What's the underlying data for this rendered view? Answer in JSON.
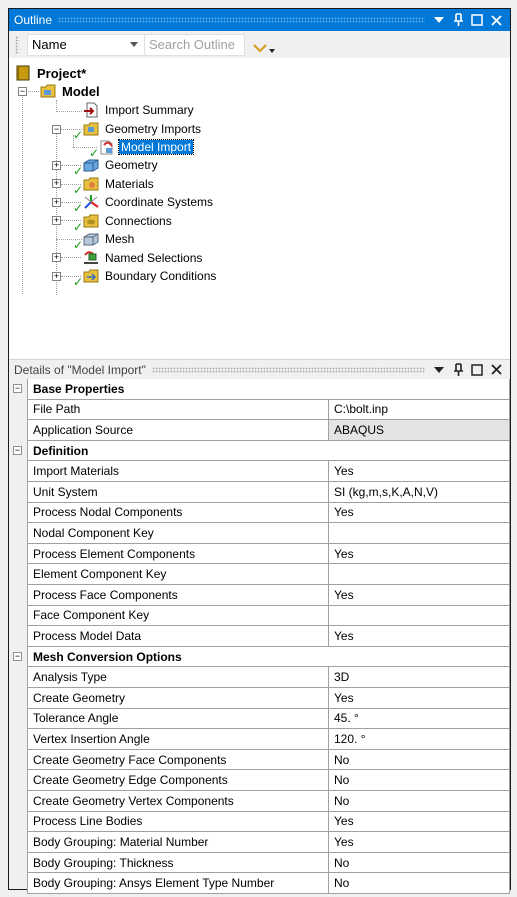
{
  "outline": {
    "title": "Outline",
    "toolbar": {
      "name_select": "Name",
      "search_placeholder": "Search Outline"
    },
    "tree": [
      {
        "label": "Project*",
        "icon": "project-icon",
        "bold": true
      },
      {
        "label": "Model",
        "icon": "model-folder-icon",
        "bold": true,
        "expander": "minus"
      },
      {
        "label": "Import Summary",
        "icon": "import-summary-icon"
      },
      {
        "label": "Geometry Imports",
        "icon": "geometry-imports-folder-icon",
        "expander": "minus",
        "check": true
      },
      {
        "label": "Model Import",
        "icon": "model-import-icon",
        "check": true,
        "selected": true
      },
      {
        "label": "Geometry",
        "icon": "geometry-icon",
        "expander": "plus",
        "check": true
      },
      {
        "label": "Materials",
        "icon": "materials-folder-icon",
        "expander": "plus",
        "check": true
      },
      {
        "label": "Coordinate Systems",
        "icon": "coordinate-systems-icon",
        "expander": "plus",
        "check": true
      },
      {
        "label": "Connections",
        "icon": "connections-folder-icon",
        "expander": "plus",
        "check": true
      },
      {
        "label": "Mesh",
        "icon": "mesh-icon",
        "check": true
      },
      {
        "label": "Named Selections",
        "icon": "named-selections-icon",
        "expander": "plus"
      },
      {
        "label": "Boundary Conditions",
        "icon": "boundary-conditions-folder-icon",
        "expander": "plus",
        "check": true
      }
    ]
  },
  "details": {
    "title": "Details of \"Model Import\"",
    "sections": [
      {
        "label": "Base Properties",
        "rows": [
          {
            "name": "File Path",
            "value": "C:\\bolt.inp"
          },
          {
            "name": "Application Source",
            "value": "ABAQUS",
            "readonly": true
          }
        ]
      },
      {
        "label": "Definition",
        "rows": [
          {
            "name": "Import Materials",
            "value": "Yes"
          },
          {
            "name": "Unit System",
            "value": "SI (kg,m,s,K,A,N,V)"
          },
          {
            "name": "Process Nodal Components",
            "value": "Yes"
          },
          {
            "name": "Nodal Component Key",
            "value": ""
          },
          {
            "name": "Process Element Components",
            "value": "Yes"
          },
          {
            "name": "Element Component Key",
            "value": ""
          },
          {
            "name": "Process Face Components",
            "value": "Yes"
          },
          {
            "name": "Face Component Key",
            "value": ""
          },
          {
            "name": "Process Model Data",
            "value": "Yes"
          }
        ]
      },
      {
        "label": "Mesh Conversion Options",
        "rows": [
          {
            "name": "Analysis Type",
            "value": "3D"
          },
          {
            "name": "Create Geometry",
            "value": "Yes"
          },
          {
            "name": "Tolerance Angle",
            "value": "45. °"
          },
          {
            "name": "Vertex Insertion Angle",
            "value": "120. °"
          },
          {
            "name": "Create Geometry Face Components",
            "value": "No"
          },
          {
            "name": "Create Geometry Edge Components",
            "value": "No"
          },
          {
            "name": "Create Geometry Vertex Components",
            "value": "No"
          },
          {
            "name": "Process Line Bodies",
            "value": "Yes"
          },
          {
            "name": "Body Grouping: Material Number",
            "value": "Yes"
          },
          {
            "name": "Body Grouping: Thickness",
            "value": "No"
          },
          {
            "name": "Body Grouping: Ansys Element Type Number",
            "value": "No"
          }
        ]
      }
    ]
  },
  "colors": {
    "titlebar_active": "#0078d7",
    "check_green": "#1a9a1a",
    "readonly_bg": "#e4e4e4"
  }
}
